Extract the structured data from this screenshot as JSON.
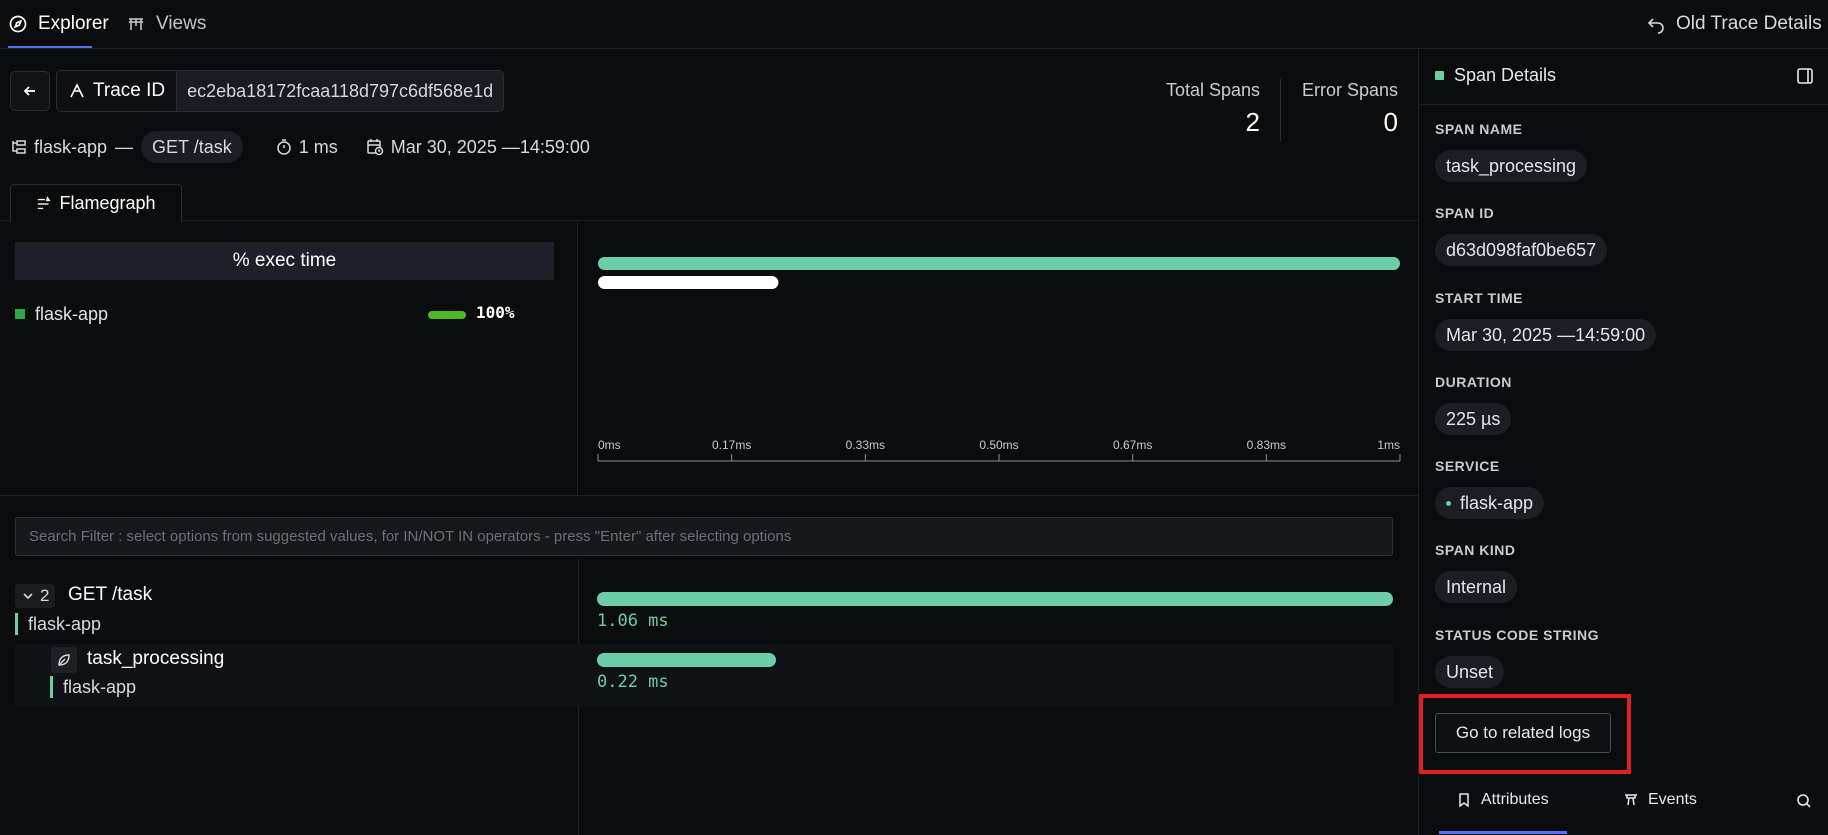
{
  "nav": {
    "tabs": [
      {
        "label": "Explorer",
        "icon": "compass-icon"
      },
      {
        "label": "Views",
        "icon": "views-icon"
      }
    ],
    "old_trace_details": "Old Trace Details"
  },
  "trace": {
    "id_label": "Trace ID",
    "id_value": "ec2eba18172fcaa118d797c6df568e1d",
    "service": "flask-app",
    "separator": "—",
    "endpoint": "GET /task",
    "duration": "1 ms",
    "timestamp": "Mar 30, 2025 —14:59:00",
    "total_spans_label": "Total Spans",
    "total_spans": "2",
    "error_spans_label": "Error Spans",
    "error_spans": "0"
  },
  "flamegraph": {
    "tab_label": "Flamegraph",
    "exec_header": "% exec time",
    "services": [
      {
        "name": "flask-app",
        "percent": "100%",
        "fraction": 1.0,
        "color": "#2aa94a"
      }
    ],
    "bars": [
      {
        "start": 0,
        "end": 1.0,
        "color": "#6bcea8"
      },
      {
        "start": 0,
        "end": 0.225,
        "color": "#ffffff"
      }
    ],
    "axis_ticks": [
      "0ms",
      "0.17ms",
      "0.33ms",
      "0.50ms",
      "0.67ms",
      "0.83ms",
      "1ms"
    ]
  },
  "search": {
    "placeholder": "Search Filter : select options from suggested values, for IN/NOT IN operators - press \"Enter\" after selecting options"
  },
  "spans": [
    {
      "count": "2",
      "name": "GET /task",
      "service": "flask-app",
      "duration": "1.06 ms",
      "fraction": 1.0
    },
    {
      "name": "task_processing",
      "service": "flask-app",
      "duration": "0.22 ms",
      "fraction": 0.225
    }
  ],
  "span_details": {
    "title": "Span Details",
    "fields": [
      {
        "label": "SPAN NAME",
        "value": "task_processing"
      },
      {
        "label": "SPAN ID",
        "value": "d63d098faf0be657"
      },
      {
        "label": "START TIME",
        "value": "Mar 30, 2025 —14:59:00"
      },
      {
        "label": "DURATION",
        "value": "225 µs"
      },
      {
        "label": "SERVICE",
        "value": "flask-app"
      },
      {
        "label": "SPAN KIND",
        "value": "Internal"
      },
      {
        "label": "STATUS CODE STRING",
        "value": "Unset"
      }
    ],
    "logs_button": "Go to related logs",
    "tabs": [
      "Attributes",
      "Events"
    ]
  },
  "colors": {
    "accent": "#4e74f8",
    "span_bar": "#6bcea8",
    "highlight": "#e01f1f",
    "service_green": "#2aa94a"
  }
}
